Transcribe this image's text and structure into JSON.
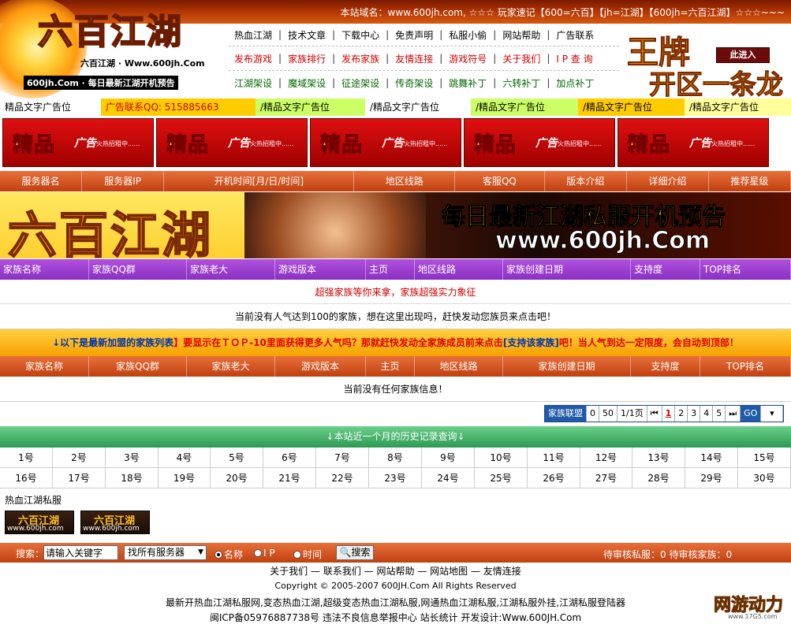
{
  "topbar": {
    "text": "本站域名：www.600jh.com, ☆☆☆ 玩家速记【600=六百】【jh=江湖】【600jh=六百江湖】☆☆☆~~~"
  },
  "logo": {
    "title": "六百江湖",
    "sub": "六百江湖 · Www.600jh.Com",
    "sub2": "600jh.Com · 每日最新江湖开机预告"
  },
  "nav": {
    "row1": [
      "热血江湖",
      "技术文章",
      "下载中心",
      "免责声明",
      "私服小偷",
      "网站帮助",
      "广告联系"
    ],
    "row2": [
      "发布游戏",
      "家族排行",
      "发布家族",
      "友情连接",
      "游戏符号",
      "关于我们",
      "I P 查 询"
    ],
    "row3": [
      "江湖架设",
      "魔域架设",
      "征途架设",
      "传奇架设",
      "跳舞补丁",
      "六转补丁",
      "加点补丁"
    ]
  },
  "promo": {
    "line1": "王牌",
    "line2": "开区一条龙",
    "enter": "此进入"
  },
  "text_ads": [
    {
      "label": "精品文字广告位",
      "bg": "#ffffff",
      "color": "#000000",
      "w": 128
    },
    {
      "label": "广告联系QQ: 515885663",
      "bg": "#ffcc00",
      "color": "#cc0000",
      "w": 196
    },
    {
      "label": "/精品文字广告位",
      "bg": "#ccff66",
      "color": "#000000",
      "w": 139
    },
    {
      "label": "/精品文字广告位",
      "bg": "#ffffff",
      "color": "#000000",
      "w": 134
    },
    {
      "label": "/精品文字广告位",
      "bg": "#ccff66",
      "color": "#000000",
      "w": 136
    },
    {
      "label": "/精品文字广告位",
      "bg": "#ffcc00",
      "color": "#000000",
      "w": 135
    },
    {
      "label": "/精品文字广告位",
      "bg": "#ffff99",
      "color": "#000000",
      "w": 135
    }
  ],
  "banner_ads": [
    {
      "b1": "精品",
      "b2": "广告",
      "b3": "火热招租中......"
    },
    {
      "b1": "精品",
      "b2": "广告",
      "b3": "火热招租中......"
    },
    {
      "b1": "精品",
      "b2": "广告",
      "b3": "火热招租中......"
    },
    {
      "b1": "精品",
      "b2": "广告",
      "b3": "火热招租中......"
    },
    {
      "b1": "精品",
      "b2": "广告",
      "b3": "火热招租中......"
    }
  ],
  "server_header": [
    "服务器名",
    "服务器IP",
    "开机时间[月/日/时间]",
    "地区线路",
    "客服QQ",
    "版本介绍",
    "详细介绍",
    "推荐星级"
  ],
  "big_banner": {
    "logo": "六百江湖",
    "t1": "每日最新江湖私服开机预告",
    "t2": "www.600jh.Com"
  },
  "family_header": [
    "家族名称",
    "家族QQ群",
    "家族老大",
    "游戏版本",
    "主页",
    "地区线路",
    "家族创建日期",
    "支持度",
    "TOP排名"
  ],
  "strong_family_text": "超强家族等你来拿，家族超强实力象征",
  "no_top_text": "当前没有人气达到100的家族，想在这里出现吗，赶快发动您族员来点击吧！",
  "notice": {
    "part1": "↓以下是最新加盟的家族列表",
    "part2": "】要显示在ＴＯＰ-10里面获得更多人气吗？那就赶快发动全家族成员前来点击",
    "part3": "[支持该家族]",
    "part4": "吧！当人气到达一定限度，会自动到顶部！"
  },
  "family_header2": [
    "家族名称",
    "家族QQ群",
    "家族老大",
    "游戏版本",
    "主页",
    "地区线路",
    "家族创建日期",
    "支持度",
    "TOP排名"
  ],
  "no_family_text": "当前没有任何家族信息！",
  "pager": {
    "label": "家族联盟",
    "count": "0",
    "per": "50",
    "pages": "1/1页",
    "first": "⏮",
    "pages_list": [
      "1",
      "2",
      "3",
      "4",
      "5"
    ],
    "last": "⏭",
    "go": "GO"
  },
  "history_title": "↓本站近一个月的历史记录查询↓",
  "days_row1": [
    "1号",
    "2号",
    "3号",
    "4号",
    "5号",
    "6号",
    "7号",
    "8号",
    "9号",
    "10号",
    "11号",
    "12号",
    "13号",
    "14号",
    "15号"
  ],
  "days_row2": [
    "16号",
    "17号",
    "18号",
    "19号",
    "20号",
    "21号",
    "22号",
    "23号",
    "24号",
    "25号",
    "26号",
    "27号",
    "28号",
    "29号",
    "30号"
  ],
  "hot_label": "热血江湖私服",
  "small_banners": [
    {
      "s1": "六百江湖",
      "s2": "www.600jh.com"
    },
    {
      "s1": "六百江湖",
      "s2": "www.600jh.com"
    }
  ],
  "search": {
    "label": "搜索：",
    "value": "请输入关键字",
    "select": "找所有服务器",
    "radio_name": "名称",
    "radio_ip": "I P",
    "radio_time": "时间",
    "button": "搜索",
    "pending": "待审核私服：0  待审核家族：0"
  },
  "footer": {
    "links": [
      "关于我们",
      "联系我们",
      "网站帮助",
      "网站地图",
      "友情连接"
    ],
    "copyright": "Copyright © 2005-2007 600JH.Com All Rights Reserved",
    "desc": "最新开热血江湖私服网,变态热血江湖,超级变态热血江湖私服,网通热血江湖私服,江湖私服外挂,江湖私服登陆器",
    "icp": "闽ICP备05976887738号    违法不良信息举报中心  站长统计    开发设计:Www.600JH.Com"
  },
  "corner": {
    "c1": "网游动力",
    "c2": "www.17G5.com"
  }
}
